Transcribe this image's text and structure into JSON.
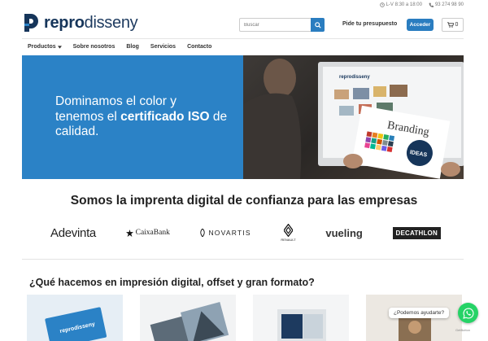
{
  "header": {
    "hours": "L-V 8:30 a 18:00",
    "phone": "93 274 98 90",
    "brand_light": "repro",
    "brand_rest": "disseny",
    "search_placeholder": "Buscar",
    "quote_link": "Pide tu presupuesto",
    "login_button": "Acceder",
    "cart_count": "0"
  },
  "nav": {
    "items": [
      "Productos",
      "Sobre nosotros",
      "Blog",
      "Servicios",
      "Contacto"
    ]
  },
  "hero": {
    "line1": "Dominamos el color y",
    "line2_pre": "tenemos el ",
    "line2_bold": "certificado ISO",
    "line2_post": " de",
    "line3": "calidad.",
    "screen_brand": "reprodisseny",
    "card_text": "Branding",
    "badge_text": "IDEAS"
  },
  "clients_section": {
    "title": "Somos la imprenta digital de confianza para las empresas",
    "logos": [
      "Adevinta",
      "CaixaBank",
      "NOVARTIS",
      "RENAULT",
      "vueling",
      "DECATHLON"
    ]
  },
  "services_section": {
    "title": "¿Qué hacemos en impresión digital, offset y gran formato?",
    "card1_brand": "reprodisseny"
  },
  "chat": {
    "bubble": "¿Podemos ayudarte?",
    "credit": "GetButton"
  },
  "colors": {
    "brand_blue": "#2b82c6",
    "navy": "#16355a",
    "whatsapp": "#25d366"
  }
}
